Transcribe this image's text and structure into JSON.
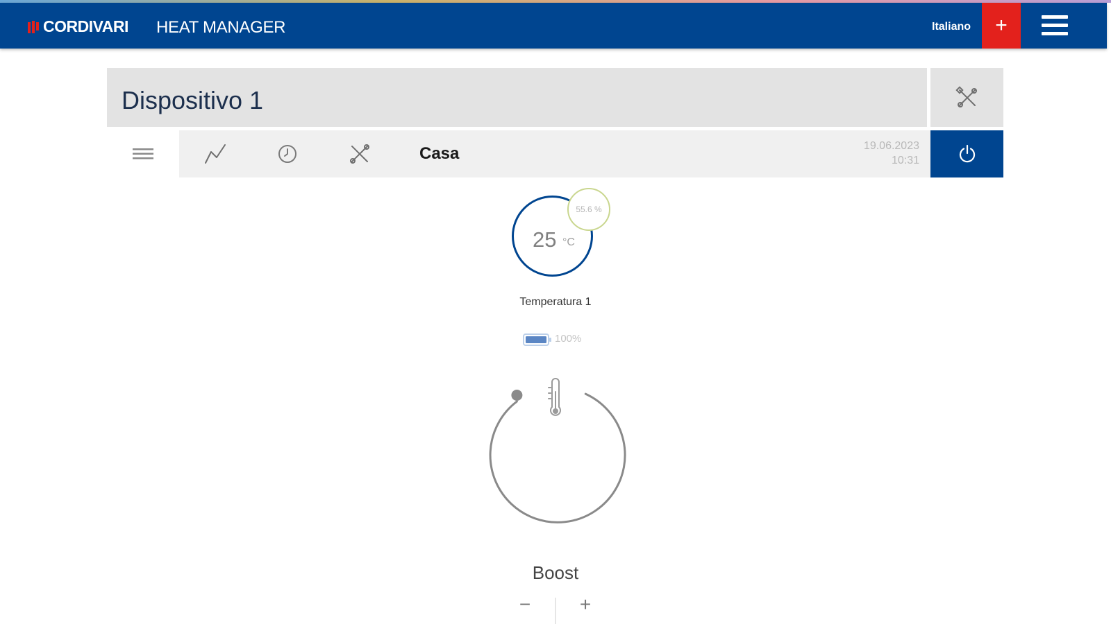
{
  "header": {
    "brand": "CORDIVARI",
    "app_title": "HEAT MANAGER",
    "language": "Italiano",
    "add_label": "+",
    "colors": {
      "bar": "#004590",
      "add": "#e3211c"
    }
  },
  "device": {
    "title": "Dispositivo 1",
    "location": "Casa",
    "date": "19.06.2023",
    "time": "10:31"
  },
  "toolbar": {
    "tabs": [
      {
        "icon": "list-icon",
        "active": true
      },
      {
        "icon": "chart-line-icon",
        "active": false
      },
      {
        "icon": "clock-icon",
        "active": false
      },
      {
        "icon": "tools-icon",
        "active": false
      }
    ]
  },
  "sensor": {
    "temperature": "25",
    "unit": "°C",
    "humidity": "55.6 %",
    "label": "Temperatura 1",
    "battery": "100%"
  },
  "boost": {
    "label": "Boost",
    "minus": "−",
    "plus": "+"
  }
}
